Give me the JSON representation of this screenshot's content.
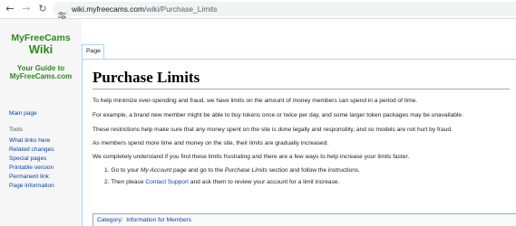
{
  "browser": {
    "nav": {
      "back_glyph": "←",
      "forward_glyph": "→",
      "reload_glyph": "↻"
    },
    "url_host": "wiki.myfreecams.com",
    "url_path": "/wiki/Purchase_Limits",
    "site_info_icon": "tune-icon"
  },
  "sidebar": {
    "logo": {
      "line1": "MyFreeCams",
      "line2": "Wiki",
      "line3": "Your Guide to",
      "line4": "MyFreeCams.com",
      "color": "#2d8a1e"
    },
    "main_page": "Main page",
    "tools_heading": "Tools",
    "tools": [
      "What links here",
      "Related changes",
      "Special pages",
      "Printable version",
      "Permanent link",
      "Page information"
    ]
  },
  "tabs": {
    "page": "Page"
  },
  "article": {
    "title": "Purchase Limits",
    "paragraphs": [
      "To help minimize over-spending and fraud, we have limits on the amount of money members can spend in a period of time.",
      "For example, a brand new member might be able to buy tokens once or twice per day, and some larger token packages may be unavailable.",
      "These restrictions help make sure that any money spent on the site is done legally and responsibly, and so models are not hurt by fraud.",
      "As members spend more time and money on the site, their limits are gradually increased.",
      "We completely understand if you find these limits frustrating and there are a few ways to help increase your limits faster."
    ],
    "steps": [
      {
        "num": "1.",
        "t1": "Go to your ",
        "em1": "My Account",
        "t2": " page and go to the ",
        "em2": "Purchase Limits",
        "t3": " section and follow the instructions."
      },
      {
        "num": "2.",
        "t1": "Then please ",
        "link": "Contact Support",
        "t2": " and ask them to review your account for a limit increase."
      }
    ],
    "category_label": "Category",
    "category_sep": ":",
    "category_value": "Information for Members"
  },
  "colors": {
    "link": "#0645ad",
    "sidebar_bg": "#f6f6f6",
    "tab_border": "#a7d7f9"
  }
}
